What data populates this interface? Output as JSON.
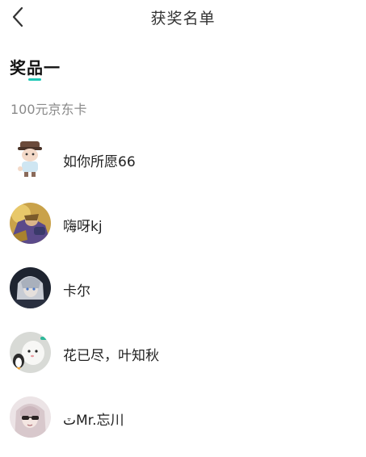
{
  "header": {
    "title": "获奖名单",
    "back_icon": "chevron-left-icon"
  },
  "prize": {
    "tab_label": "奖品一",
    "accent_color": "#1fc8b6",
    "name": "100元京东卡"
  },
  "winners": [
    {
      "name": "如你所愿66"
    },
    {
      "name": "嗨呀kj"
    },
    {
      "name": "卡尔"
    },
    {
      "name": "花已尽，叶知秋"
    },
    {
      "name": "ٽMr.忘川"
    }
  ]
}
